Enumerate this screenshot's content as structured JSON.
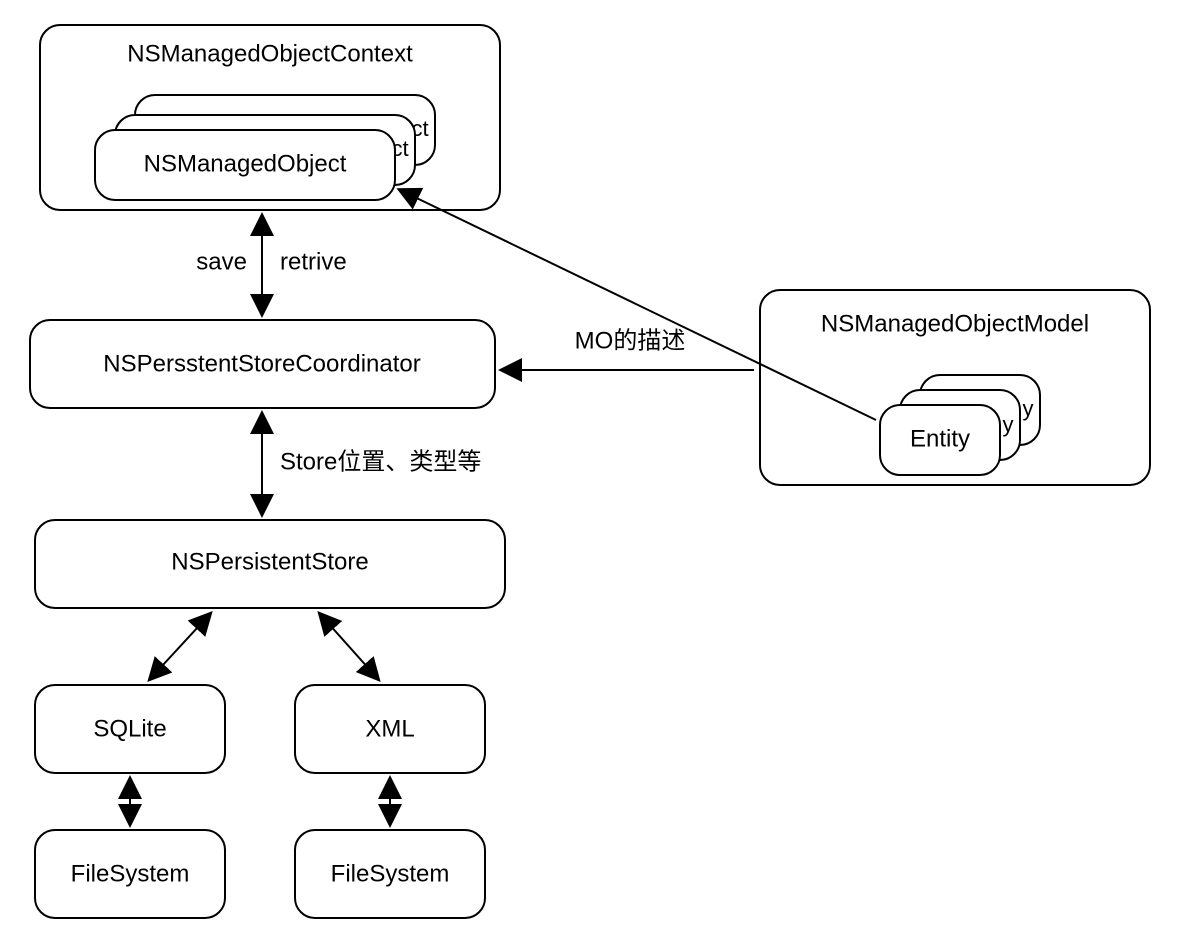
{
  "nodes": {
    "context": "NSManagedObjectContext",
    "managedObject": "NSManagedObject",
    "coordinator": "NSPersstentStoreCoordinator",
    "persistentStore": "NSPersistentStore",
    "sqlite": "SQLite",
    "xml": "XML",
    "filesystem1": "FileSystem",
    "filesystem2": "FileSystem",
    "model": "NSManagedObjectModel",
    "entity": "Entity",
    "stackSuffix1": "ct",
    "stackSuffix2": "ct",
    "entitySuffix1": "y",
    "entitySuffix2": "y"
  },
  "edges": {
    "save": "save",
    "retrive": "retrive",
    "modesc": "MO的描述",
    "storeInfo": "Store位置、类型等"
  }
}
